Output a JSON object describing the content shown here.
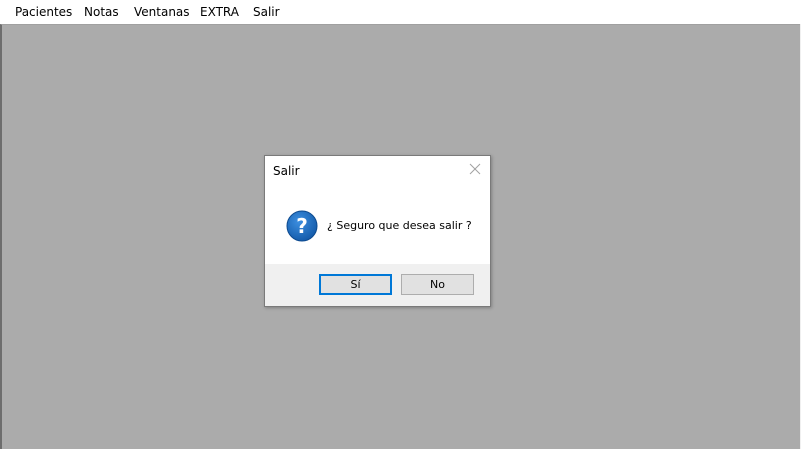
{
  "menubar": {
    "items": [
      "Pacientes",
      "Notas",
      "Ventanas",
      "EXTRA",
      "Salir"
    ]
  },
  "dialog": {
    "title": "Salir",
    "message": "¿ Seguro que desea salir ?",
    "icon": "question-icon",
    "yes_label": "Sí",
    "no_label": "No"
  },
  "colors": {
    "mdi_background": "#ababab",
    "dialog_footer": "#f0f0f0",
    "icon_blue": "#1a6bbf",
    "default_button_border": "#0078d7"
  }
}
